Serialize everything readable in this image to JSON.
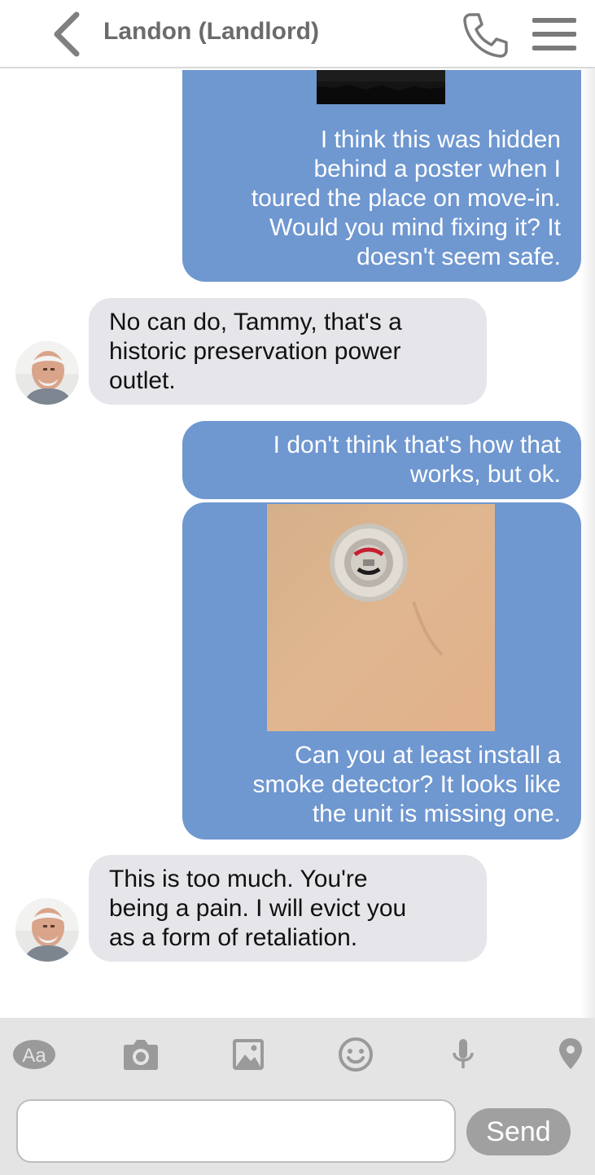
{
  "header": {
    "contact_name": "Landon (Landlord)",
    "back_icon": "chevron-left-icon",
    "call_icon": "phone-icon",
    "menu_icon": "hamburger-menu-icon"
  },
  "messages": [
    {
      "from": "me",
      "type": "image",
      "image": "dark photo (top cropped)"
    },
    {
      "from": "me",
      "type": "text",
      "text": "I think this was hidden\nbehind a poster when I\ntoured the place on move-in.\nWould you mind fixing it? It\ndoesn't seem safe."
    },
    {
      "from": "landlord",
      "type": "text",
      "text": "No can do, Tammy, that's a\nhistoric preservation power\noutlet."
    },
    {
      "from": "me",
      "type": "text",
      "text": "I don't think that's how that\nworks, but ok."
    },
    {
      "from": "me",
      "type": "image",
      "image": "ceiling smoke detector mounting base"
    },
    {
      "from": "me",
      "type": "text",
      "text": "Can you at least install a\nsmoke detector? It looks like\nthe unit is missing one."
    },
    {
      "from": "landlord",
      "type": "text",
      "text": "This is too much. You're\nbeing a pain. I will evict you\nas a form of retaliation."
    }
  ],
  "toolbar": {
    "icons": [
      "text-format-icon",
      "camera-icon",
      "image-icon",
      "emoji-icon",
      "microphone-icon",
      "location-pin-icon"
    ],
    "text_format_label": "Aa"
  },
  "composer": {
    "input_value": "",
    "input_placeholder": "",
    "send_label": "Send"
  },
  "colors": {
    "outgoing_bubble": "#6f97d0",
    "incoming_bubble": "#e5e5ea",
    "toolbar_bg": "#e4e4e4",
    "icon_gray": "#9a9a9a",
    "send_button": "#a0a0a0"
  }
}
